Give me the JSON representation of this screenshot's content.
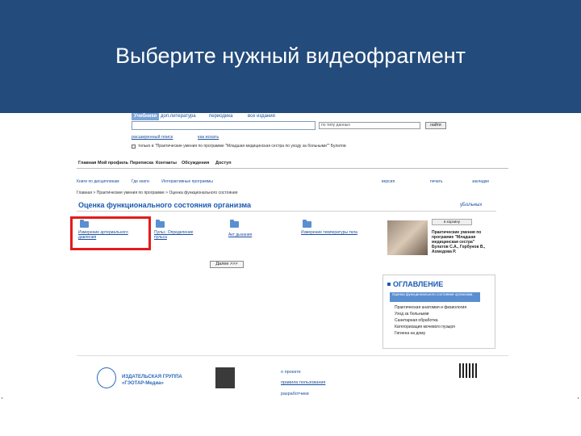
{
  "slide": {
    "title": "Выберите нужный видеофрагмент"
  },
  "tabs": [
    "Учебники",
    "доп.литература",
    "периодика",
    "все издания"
  ],
  "search": {
    "value": "",
    "select_value": "по типу данных",
    "button": "найти"
  },
  "search_links": {
    "advanced": "расширенный поиск",
    "how": "как искать"
  },
  "checkbox_text": "только в \"Практические умения по программе \"Младшая медицинская сестра по уходу за больными\"\" Булатов",
  "nav": [
    "Главная",
    "Мой профиль",
    "Переписка",
    "Контакты",
    "Обсуждения",
    "Доступ"
  ],
  "sub": [
    "Книги по дисциплинам",
    "Где книги",
    "Интерактивные программы"
  ],
  "tools": [
    "версия",
    "печать",
    "закладки"
  ],
  "breadcrumb": "Главная > Практические умения по программе > Оценка функционального состояния",
  "page_title": "Оценка функционального состояния организма",
  "print_link": "уБольных",
  "fragments": [
    {
      "label": "Измерение артериального давления"
    },
    {
      "label": "Пульс. Определение пульса"
    },
    {
      "label": "Акт дыхания"
    },
    {
      "label": "Измерение температуры тела"
    }
  ],
  "next_button": "Далее >>>",
  "book": {
    "button": "в корзину",
    "desc": "Практические умения по программе \"Младшая медицинская сестра\" Булатов С.А., Горбунов В., Ахмедова Р."
  },
  "toc": {
    "title": "ОГЛАВЛЕНИЕ",
    "highlight": "Оценка функционального состояния организма",
    "items": [
      "Практическая анатомия и физиология",
      "Уход за больными",
      "Санитарная обработка",
      "Категоризация мочевого пузыря",
      "Гигиена на дому"
    ]
  },
  "footer": {
    "publisher_line1": "ИЗДАТЕЛЬСКАЯ ГРУППА",
    "publisher_line2": "«ГЭОТАР-Медиа»",
    "links": [
      "о проекте",
      "правила пользования",
      "разработчики"
    ]
  }
}
